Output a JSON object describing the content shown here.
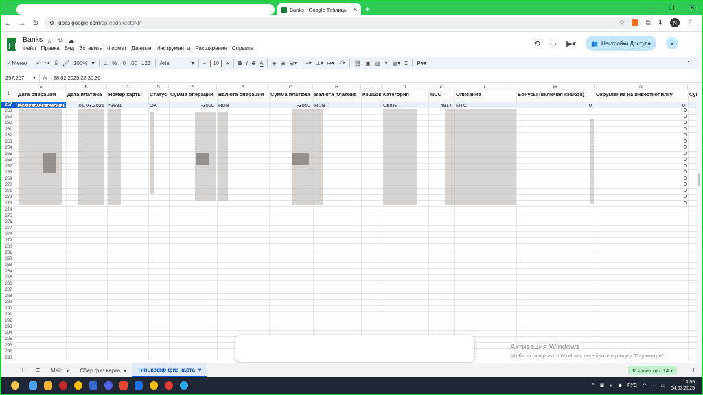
{
  "browser": {
    "tab_title": "Banks - Google Таблицы",
    "url_host": "docs.google.com",
    "url_path": "/spreadsheets/d/",
    "avatar_letter": "N"
  },
  "doc": {
    "title": "Banks",
    "menu": [
      "Файл",
      "Правка",
      "Вид",
      "Вставить",
      "Формат",
      "Данные",
      "Инструменты",
      "Расширения",
      "Справка"
    ],
    "share_label": "Настройки Доступа"
  },
  "toolbar": {
    "search_label": "Меню",
    "zoom": "100%",
    "currency": "р.",
    "percent": "%",
    "decimals_dec": ".0",
    "decimals_inc": ".00",
    "format_123": "123",
    "font": "Arial",
    "font_size": "10"
  },
  "formula_bar": {
    "name_box": "257:257",
    "fx": "fx",
    "value": "28.02.2025 22:30:30"
  },
  "grid": {
    "columns": [
      "A",
      "B",
      "C",
      "D",
      "E",
      "F",
      "G",
      "H",
      "I",
      "J",
      "K",
      "L",
      "M",
      "N"
    ],
    "headers": [
      "Дата операции",
      "Дата платежа",
      "Номер карты",
      "Статус",
      "Сумма операции",
      "Валюта операции",
      "Сумма платежа",
      "Валюта платежа",
      "Кэшбэк",
      "Категория",
      "MCC",
      "Описание",
      "Бонусы (включая кэшбэк)",
      "Округление на инвесткопилку",
      "Сумм"
    ],
    "header_row_num": "1",
    "selected_row": {
      "num": "257",
      "date_op": "28.02.2025 22:30:30",
      "date_pay": "01.03.2025",
      "card": "*3691",
      "status": "OK",
      "sum_op": "-3000",
      "cur_op": "RUB",
      "sum_pay": "-3000",
      "cur_pay": "RUB",
      "category": "Связь",
      "mcc": "4814",
      "description": "МТС",
      "bonus": "0",
      "rounding": "0"
    },
    "row_numbers": [
      "258",
      "259",
      "260",
      "261",
      "262",
      "263",
      "264",
      "265",
      "266",
      "267",
      "268",
      "269",
      "270",
      "271",
      "272",
      "273",
      "274",
      "275",
      "276",
      "277",
      "278",
      "279",
      "280",
      "281",
      "282",
      "283",
      "284",
      "285",
      "286",
      "287",
      "288",
      "289",
      "290",
      "291",
      "292",
      "293",
      "294",
      "295",
      "296",
      "297",
      "298"
    ],
    "zero_value": "0"
  },
  "watermark": {
    "line1": "Активация Windows",
    "line2": "Чтобы активировать Windows, перейдите в раздел \"Параметры\"."
  },
  "sheets": {
    "tabs": [
      "Main",
      "Сбер физ карта",
      "Тинькофф физ карта"
    ],
    "active": 2,
    "count_label": "Количество: 14"
  },
  "taskbar": {
    "lang": "РУС",
    "time": "13:55",
    "date": "04.03.2025"
  }
}
